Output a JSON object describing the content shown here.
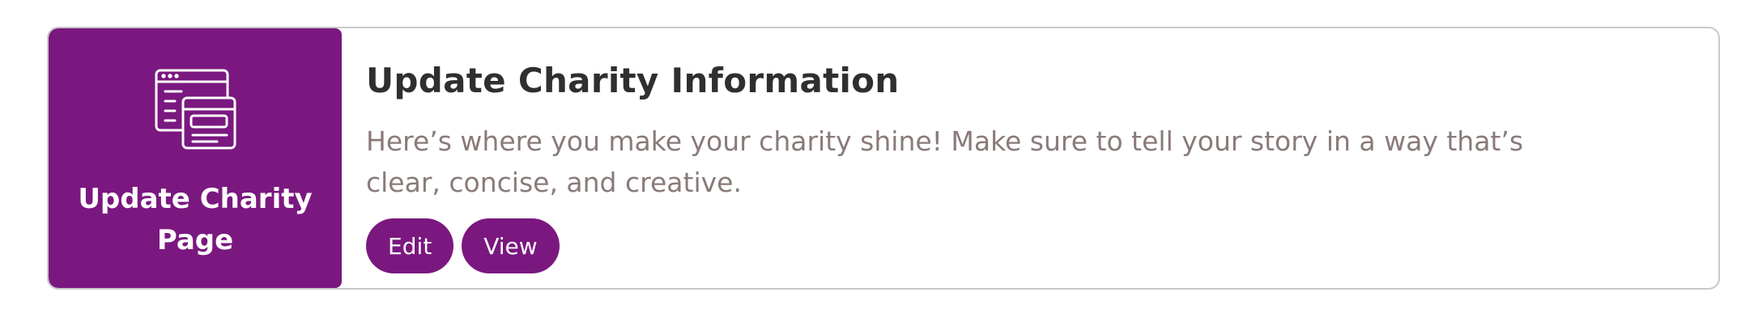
{
  "tile": {
    "icon": "browser-windows-icon",
    "label": "Update Charity Page",
    "background_color": "#7a187f"
  },
  "main": {
    "title": "Update Charity Information",
    "description": "Here’s where you make your charity shine! Make sure to tell your story in a way that’s clear, concise, and creative."
  },
  "actions": {
    "edit_label": "Edit",
    "view_label": "View",
    "button_color": "#7a187f"
  }
}
